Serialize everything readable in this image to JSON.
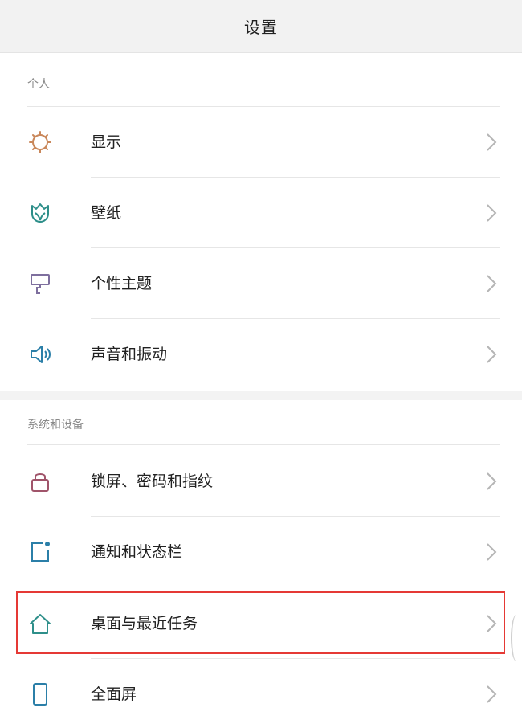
{
  "header": {
    "title": "设置"
  },
  "sections": [
    {
      "title": "个人",
      "items": [
        {
          "label": "显示",
          "icon": "sun-icon",
          "color": "#c9875a"
        },
        {
          "label": "壁纸",
          "icon": "tulip-icon",
          "color": "#2e8f8a"
        },
        {
          "label": "个性主题",
          "icon": "brush-icon",
          "color": "#7e6f9e"
        },
        {
          "label": "声音和振动",
          "icon": "speaker-icon",
          "color": "#2b7fa8"
        }
      ]
    },
    {
      "title": "系统和设备",
      "items": [
        {
          "label": "锁屏、密码和指纹",
          "icon": "lock-icon",
          "color": "#a0546a"
        },
        {
          "label": "通知和状态栏",
          "icon": "notification-icon",
          "color": "#2b7fa8"
        },
        {
          "label": "桌面与最近任务",
          "icon": "home-icon",
          "color": "#2e8f8a"
        },
        {
          "label": "全面屏",
          "icon": "phone-icon",
          "color": "#2b7fa8"
        }
      ]
    }
  ],
  "colors": {
    "highlight": "#e53935",
    "chevron": "#b5b5b5"
  }
}
